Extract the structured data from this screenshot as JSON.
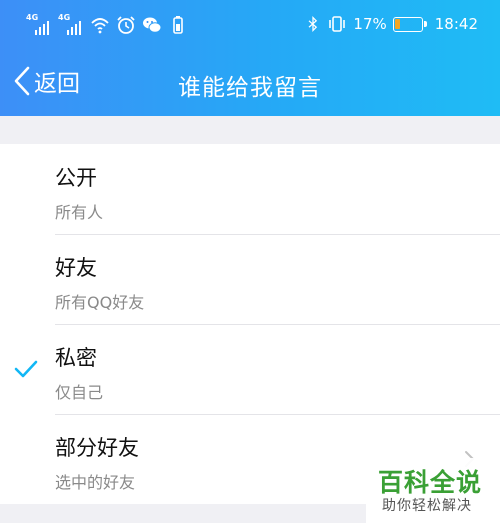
{
  "status_bar": {
    "signal_1": "4G",
    "signal_2": "4G",
    "battery_percent": "17%",
    "battery_level": 0.17,
    "time": "18:42"
  },
  "nav": {
    "back_label": "返回",
    "title": "谁能给我留言"
  },
  "options": [
    {
      "name": "公开",
      "desc": "所有人"
    },
    {
      "name": "好友",
      "desc": "所有QQ好友"
    },
    {
      "name": "私密",
      "desc": "仅自己"
    },
    {
      "name": "部分好友",
      "desc": "选中的好友"
    }
  ],
  "selected_option": "私密",
  "watermark": {
    "main": "百科全说",
    "sub": "助你轻松解决"
  },
  "colors": {
    "header_gradient_start": "#3d8ff7",
    "header_gradient_end": "#1fbcf5",
    "check": "#12b7f5",
    "battery_fill": "#f5a623",
    "watermark_green": "#3aa035"
  }
}
